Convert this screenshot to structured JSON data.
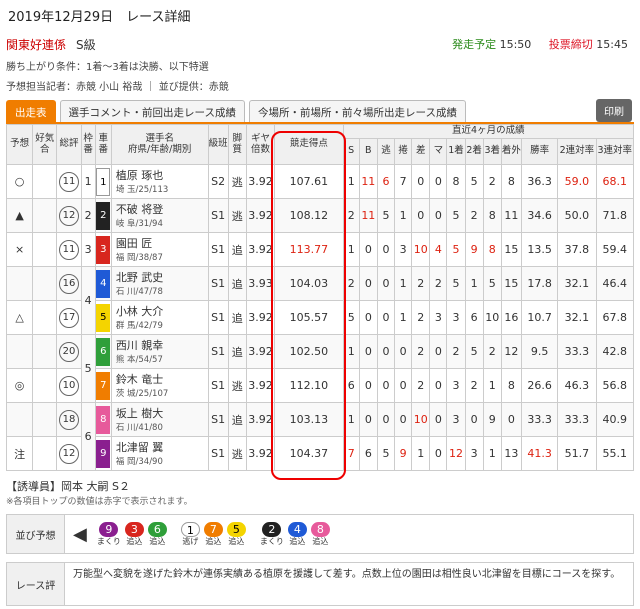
{
  "header": {
    "date": "2019年12月29日　レース詳細",
    "race": "関東好連係",
    "grade": "S級",
    "start_label": "発走予定",
    "start_time": "15:50",
    "close_label": "投票締切",
    "close_time": "15:45"
  },
  "info": {
    "line1": "勝ち上がり条件：1着〜3着は決勝、以下特選",
    "line2": "予想担当記者：赤競 小山 裕哉 ｜ 並び提供：赤競"
  },
  "tabs": [
    "出走表",
    "選手コメント・前回出走レース成績",
    "今場所・前場所・前々場所出走レース成績"
  ],
  "print": "印刷",
  "headers": {
    "yoso": "予想",
    "kokyo": "好気合",
    "sohyo": "総評",
    "waku": "枠番",
    "sha": "車番",
    "name": "選手名",
    "name2": "府県/年齢/期別",
    "kyu": "級班",
    "kyaku": "脚質",
    "gear": "ギヤ倍数",
    "score": "競走得点",
    "recent": "直近4ヶ月の成績",
    "cols": [
      "S",
      "B",
      "逃",
      "捲",
      "差",
      "マ",
      "1着",
      "2着",
      "3着",
      "着外",
      "勝率",
      "2連対率",
      "3連対率"
    ]
  },
  "rows": [
    {
      "yoso": "○",
      "sohyo": "11",
      "waku": "1",
      "sha": "1",
      "color": "#ffffff",
      "tc": "#000",
      "name": "植原 琢也",
      "sub": "埼 玉/25/113",
      "kyu": "S2",
      "kyaku": "逃",
      "gear": "3.92",
      "score": "107.61",
      "scoreRed": false,
      "vals": [
        "1",
        "11",
        "6",
        "7",
        "0",
        "0",
        "8",
        "5",
        "2",
        "8",
        "36.3",
        "59.0",
        "68.1"
      ],
      "red": [
        1,
        2,
        11,
        12
      ]
    },
    {
      "yoso": "▲",
      "sohyo": "12",
      "waku": "2",
      "sha": "2",
      "color": "#222222",
      "tc": "#fff",
      "name": "不破 将登",
      "sub": "岐 阜/31/94",
      "kyu": "S1",
      "kyaku": "逃",
      "gear": "3.92",
      "score": "108.12",
      "scoreRed": false,
      "vals": [
        "2",
        "11",
        "5",
        "1",
        "0",
        "0",
        "5",
        "2",
        "8",
        "11",
        "34.6",
        "50.0",
        "71.8"
      ],
      "red": [
        1
      ]
    },
    {
      "yoso": "×",
      "sohyo": "11",
      "waku": "3",
      "sha": "3",
      "color": "#d8261e",
      "tc": "#fff",
      "name": "園田 匠",
      "sub": "福 岡/38/87",
      "kyu": "S1",
      "kyaku": "追",
      "gear": "3.92",
      "score": "113.77",
      "scoreRed": true,
      "vals": [
        "1",
        "0",
        "0",
        "3",
        "10",
        "4",
        "5",
        "9",
        "8",
        "15",
        "13.5",
        "37.8",
        "59.4"
      ],
      "red": [
        4,
        5,
        6,
        7,
        8
      ]
    },
    {
      "yoso": "",
      "sohyo": "16",
      "waku": "4",
      "sha": "4",
      "color": "#1f5ad6",
      "tc": "#fff",
      "name": "北野 武史",
      "sub": "石 川/47/78",
      "kyu": "S1",
      "kyaku": "追",
      "gear": "3.93",
      "score": "104.03",
      "scoreRed": false,
      "vals": [
        "2",
        "0",
        "0",
        "1",
        "2",
        "2",
        "5",
        "1",
        "5",
        "15",
        "17.8",
        "32.1",
        "46.4"
      ],
      "red": []
    },
    {
      "yoso": "△",
      "sohyo": "17",
      "waku": "4",
      "sha": "5",
      "color": "#f4d400",
      "tc": "#000",
      "name": "小林 大介",
      "sub": "群 馬/42/79",
      "kyu": "S1",
      "kyaku": "追",
      "gear": "3.92",
      "score": "105.57",
      "scoreRed": false,
      "vals": [
        "5",
        "0",
        "0",
        "1",
        "2",
        "3",
        "3",
        "6",
        "10",
        "16",
        "10.7",
        "32.1",
        "67.8"
      ],
      "red": []
    },
    {
      "yoso": "",
      "sohyo": "20",
      "waku": "5",
      "sha": "6",
      "color": "#2f9f3a",
      "tc": "#fff",
      "name": "西川 親幸",
      "sub": "熊 本/54/57",
      "kyu": "S1",
      "kyaku": "追",
      "gear": "3.92",
      "score": "102.50",
      "scoreRed": false,
      "vals": [
        "1",
        "0",
        "0",
        "0",
        "2",
        "0",
        "2",
        "5",
        "2",
        "12",
        "9.5",
        "33.3",
        "42.8"
      ],
      "red": []
    },
    {
      "yoso": "◎",
      "sohyo": "10",
      "waku": "5",
      "sha": "7",
      "color": "#f07d00",
      "tc": "#fff",
      "name": "鈴木 竜士",
      "sub": "茨 城/25/107",
      "kyu": "S1",
      "kyaku": "逃",
      "gear": "3.92",
      "score": "112.10",
      "scoreRed": false,
      "vals": [
        "6",
        "0",
        "0",
        "0",
        "2",
        "0",
        "3",
        "2",
        "1",
        "8",
        "26.6",
        "46.3",
        "56.8"
      ],
      "red": []
    },
    {
      "yoso": "",
      "sohyo": "18",
      "waku": "6",
      "sha": "8",
      "color": "#e75a9b",
      "tc": "#fff",
      "name": "坂上 樹大",
      "sub": "石 川/41/80",
      "kyu": "S1",
      "kyaku": "追",
      "gear": "3.92",
      "score": "103.13",
      "scoreRed": false,
      "vals": [
        "1",
        "0",
        "0",
        "0",
        "10",
        "0",
        "3",
        "0",
        "9",
        "0",
        "33.3",
        "33.3",
        "40.9"
      ],
      "red": [
        4
      ]
    },
    {
      "yoso": "注",
      "sohyo": "12",
      "waku": "6",
      "sha": "9",
      "color": "#8a1f8f",
      "tc": "#fff",
      "name": "北津留 翼",
      "sub": "福 岡/34/90",
      "kyu": "S1",
      "kyaku": "逃",
      "gear": "3.92",
      "score": "104.37",
      "scoreRed": false,
      "vals": [
        "7",
        "6",
        "5",
        "9",
        "1",
        "0",
        "12",
        "3",
        "1",
        "13",
        "41.3",
        "51.7",
        "55.1"
      ],
      "red": [
        0,
        3,
        6,
        10
      ]
    }
  ],
  "guide": "【誘導員】岡本 大嗣 S２",
  "note": "※各項目トップの数値は赤字で表示されます。",
  "narabi": {
    "label": "並び予想",
    "groups": [
      [
        {
          "n": "9",
          "c": "#8a1f8f",
          "t": "まくり"
        },
        {
          "n": "3",
          "c": "#d8261e",
          "t": "追込"
        },
        {
          "n": "6",
          "c": "#2f9f3a",
          "t": "追込"
        }
      ],
      [
        {
          "n": "1",
          "c": "#ffffff",
          "t": "逃げ"
        },
        {
          "n": "7",
          "c": "#f07d00",
          "t": "追込"
        },
        {
          "n": "5",
          "c": "#f4d400",
          "t": "追込"
        }
      ],
      [
        {
          "n": "2",
          "c": "#222222",
          "t": "まくり"
        },
        {
          "n": "4",
          "c": "#1f5ad6",
          "t": "追込"
        },
        {
          "n": "8",
          "c": "#e75a9b",
          "t": "追込"
        }
      ]
    ]
  },
  "hyou": {
    "label": "レース評",
    "text": "万能型へ変貌を遂げた鈴木が連係実績ある植原を援護して差す。点数上位の園田は相性良い北津留を目標にコースを探す。"
  }
}
